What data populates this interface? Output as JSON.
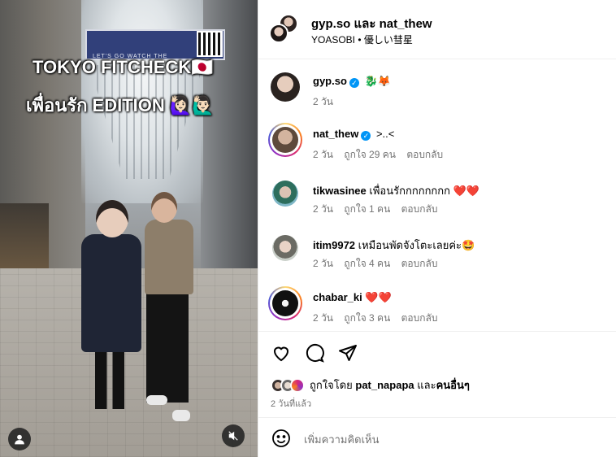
{
  "media": {
    "overlay_line1": "TOKYO FITCHECK🇯🇵",
    "overlay_line2": "เพื่อนรัก EDITION 🙋🏻‍♀️🙋🏻‍♂️",
    "banner_text": "LET'S GO WATCH THE",
    "user_icon": "user-icon",
    "mute_icon": "speaker-muted-icon"
  },
  "header": {
    "names": "gyp.so และ nat_thew",
    "audio": "YOASOBI • 優しい彗星"
  },
  "comments": [
    {
      "user": "gyp.so",
      "verified": true,
      "text": "🐉🦊",
      "meta_time": "2 วัน",
      "likes": "",
      "reply": ""
    },
    {
      "user": "nat_thew",
      "verified": true,
      "text": ">..<",
      "meta_time": "2 วัน",
      "likes": "ถูกใจ 29 คน",
      "reply": "ตอบกลับ"
    },
    {
      "user": "tikwasinee",
      "verified": false,
      "text": "เพื่อนรักกกกกกกก ❤️❤️",
      "meta_time": "2 วัน",
      "likes": "ถูกใจ 1 คน",
      "reply": "ตอบกลับ"
    },
    {
      "user": "itim9972",
      "verified": false,
      "text": "เหมือนพัดจังโตะเลยค่ะ🤩",
      "meta_time": "2 วัน",
      "likes": "ถูกใจ 4 คน",
      "reply": "ตอบกลับ"
    },
    {
      "user": "chabar_ki",
      "verified": false,
      "text": "❤️❤️",
      "meta_time": "2 วัน",
      "likes": "ถูกใจ 3 คน",
      "reply": "ตอบกลับ"
    }
  ],
  "actions": {
    "like_icon": "heart-icon",
    "comment_icon": "comment-icon",
    "share_icon": "send-icon",
    "likes_prefix": "ถูกใจโดย ",
    "likes_user": "pat_napapa",
    "likes_and": " และ",
    "likes_others": "คนอื่นๆ",
    "posted_time": "2 วันที่แล้ว"
  },
  "add_comment": {
    "emoji_icon": "emoji-icon",
    "placeholder": "เพิ่มความคิดเห็น"
  },
  "colors": {
    "verified": "#0095f6",
    "meta_text": "#737373",
    "divider": "#efefef",
    "heart": "#e0182f"
  }
}
